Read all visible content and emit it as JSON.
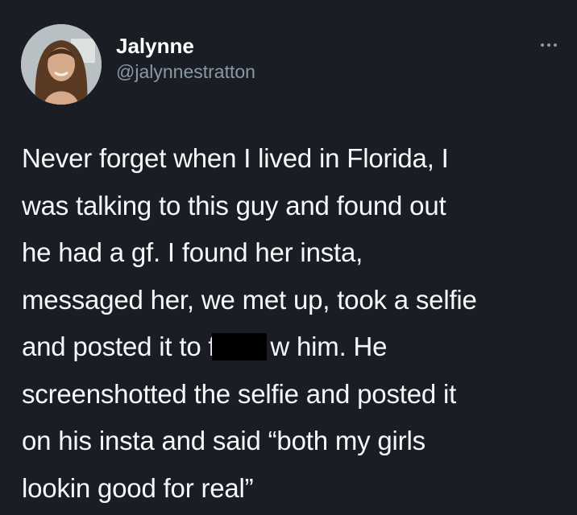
{
  "tweet": {
    "author": {
      "display_name": "Jalynne",
      "handle": "@jalynnestratton",
      "avatar_icon": "profile-photo"
    },
    "more_icon": "ellipsis-icon",
    "lines": [
      "Never forget when I lived in Florida, I",
      "was talking to this guy and found out",
      "he had a gf. I found her insta,",
      "messaged her, we met up, took a selfie",
      "and posted it to f",
      "w him. He",
      "screenshotted the selfie and posted it",
      "on his insta and said “both my girls",
      "lookin good for real”"
    ]
  },
  "colors": {
    "background": "#1a1d24",
    "text": "#f5f8fa",
    "secondary_text": "#8899a6",
    "censor_bar": "#000000"
  }
}
